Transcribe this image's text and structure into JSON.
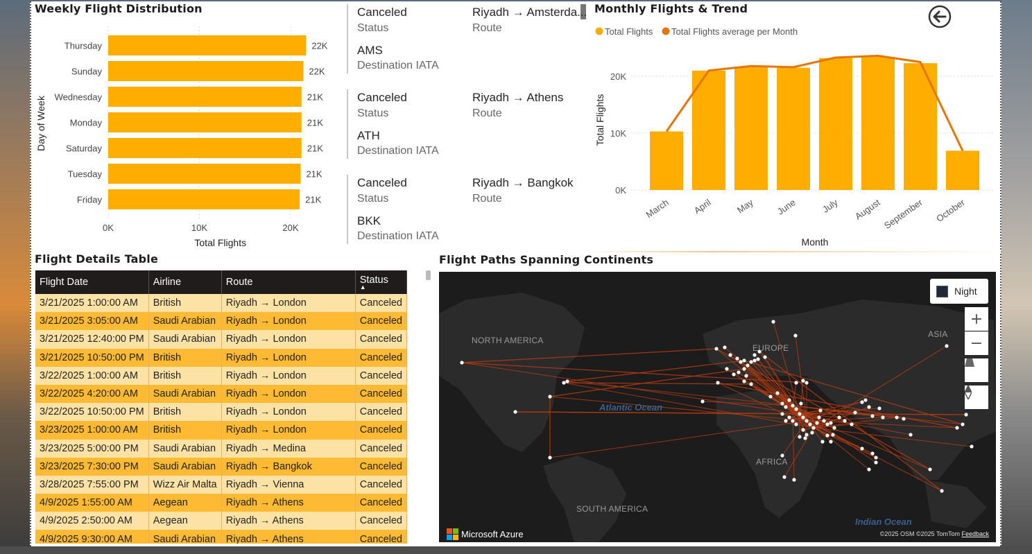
{
  "weekly": {
    "title": "Weekly Flight Distribution",
    "ylabel": "Day of Week",
    "xlabel": "Total Flights",
    "xticks": [
      "0K",
      "10K",
      "20K"
    ]
  },
  "cards": [
    {
      "status": "Canceled",
      "status_label": "Status",
      "route": "Riyadh → Amsterda...",
      "route_label": "Route",
      "iata": "AMS",
      "iata_label": "Destination IATA"
    },
    {
      "status": "Canceled",
      "status_label": "Status",
      "route": "Riyadh → Athens",
      "route_label": "Route",
      "iata": "ATH",
      "iata_label": "Destination IATA"
    },
    {
      "status": "Canceled",
      "status_label": "Status",
      "route": "Riyadh → Bangkok",
      "route_label": "Route",
      "iata": "BKK",
      "iata_label": "Destination IATA"
    }
  ],
  "monthly": {
    "title": "Monthly Flights & Trend",
    "legend": [
      "Total Flights",
      "Total Flights average per Month"
    ],
    "ylabel": "Total Flights",
    "xlabel": "Month",
    "yticks": [
      "0K",
      "10K",
      "20K"
    ]
  },
  "table": {
    "title": "Flight Details Table",
    "columns": [
      "Flight Date",
      "Airline",
      "Route",
      "Status"
    ],
    "rows": [
      [
        "3/21/2025 1:00:00 AM",
        "British",
        "Riyadh → London",
        "Canceled"
      ],
      [
        "3/21/2025 3:05:00 AM",
        "Saudi Arabian",
        "Riyadh → London",
        "Canceled"
      ],
      [
        "3/21/2025 12:40:00 PM",
        "Saudi Arabian",
        "Riyadh → London",
        "Canceled"
      ],
      [
        "3/21/2025 10:50:00 PM",
        "British",
        "Riyadh → London",
        "Canceled"
      ],
      [
        "3/22/2025 1:00:00 AM",
        "British",
        "Riyadh → London",
        "Canceled"
      ],
      [
        "3/22/2025 4:20:00 AM",
        "Saudi Arabian",
        "Riyadh → London",
        "Canceled"
      ],
      [
        "3/22/2025 10:50:00 PM",
        "British",
        "Riyadh → London",
        "Canceled"
      ],
      [
        "3/23/2025 1:00:00 AM",
        "British",
        "Riyadh → London",
        "Canceled"
      ],
      [
        "3/23/2025 5:00:00 PM",
        "Saudi Arabian",
        "Riyadh → Medina",
        "Canceled"
      ],
      [
        "3/23/2025 7:30:00 PM",
        "Saudi Arabian",
        "Riyadh → Bangkok",
        "Canceled"
      ],
      [
        "3/28/2025 7:55:00 PM",
        "Wizz Air Malta",
        "Riyadh → Vienna",
        "Canceled"
      ],
      [
        "4/9/2025 1:55:00 AM",
        "Aegean",
        "Riyadh → Athens",
        "Canceled"
      ],
      [
        "4/9/2025 2:50:00 AM",
        "Aegean",
        "Riyadh → Athens",
        "Canceled"
      ],
      [
        "4/9/2025 9:30:00 AM",
        "Saudi Arabian",
        "Riyadh → Athens",
        "Canceled"
      ]
    ]
  },
  "map": {
    "title": "Flight Paths Spanning Continents",
    "labels": {
      "north_america": "NORTH AMERICA",
      "europe": "EUROPE",
      "asia": "ASIA",
      "africa": "AFRICA",
      "south_america": "SOUTH AMERICA"
    },
    "oceans": {
      "atlantic": "Atlantic Ocean",
      "indian": "Indian Ocean"
    },
    "style_button": "Night",
    "brand": "Microsoft Azure",
    "copyright": "©2025 OSM  ©2025 TomTom",
    "feedback": "Feedback"
  },
  "colors": {
    "accent": "#FFAE00",
    "trend": "#E8740C",
    "route_line": "#B23A10",
    "table_dark": "#201C1C"
  },
  "chart_data": [
    {
      "type": "bar",
      "orientation": "horizontal",
      "title": "Weekly Flight Distribution",
      "xlabel": "Total Flights",
      "ylabel": "Day of Week",
      "xlim": [
        0,
        23000
      ],
      "categories": [
        "Thursday",
        "Sunday",
        "Wednesday",
        "Monday",
        "Saturday",
        "Tuesday",
        "Friday"
      ],
      "values": [
        21700,
        21400,
        21200,
        21200,
        21200,
        21100,
        21000
      ],
      "data_labels": [
        "22K",
        "22K",
        "21K",
        "21K",
        "21K",
        "21K",
        "21K"
      ]
    },
    {
      "type": "bar",
      "title": "Monthly Flights & Trend",
      "xlabel": "Month",
      "ylabel": "Total Flights",
      "ylim": [
        0,
        25000
      ],
      "categories": [
        "March",
        "April",
        "May",
        "June",
        "July",
        "August",
        "September",
        "October"
      ],
      "series": [
        {
          "name": "Total Flights",
          "type": "bar",
          "values": [
            10300,
            21000,
            21700,
            21500,
            23200,
            23400,
            22300,
            6900
          ]
        },
        {
          "name": "Total Flights average per Month",
          "type": "line",
          "values": [
            10300,
            21000,
            21800,
            21600,
            23300,
            23600,
            22500,
            6900
          ]
        }
      ]
    }
  ]
}
